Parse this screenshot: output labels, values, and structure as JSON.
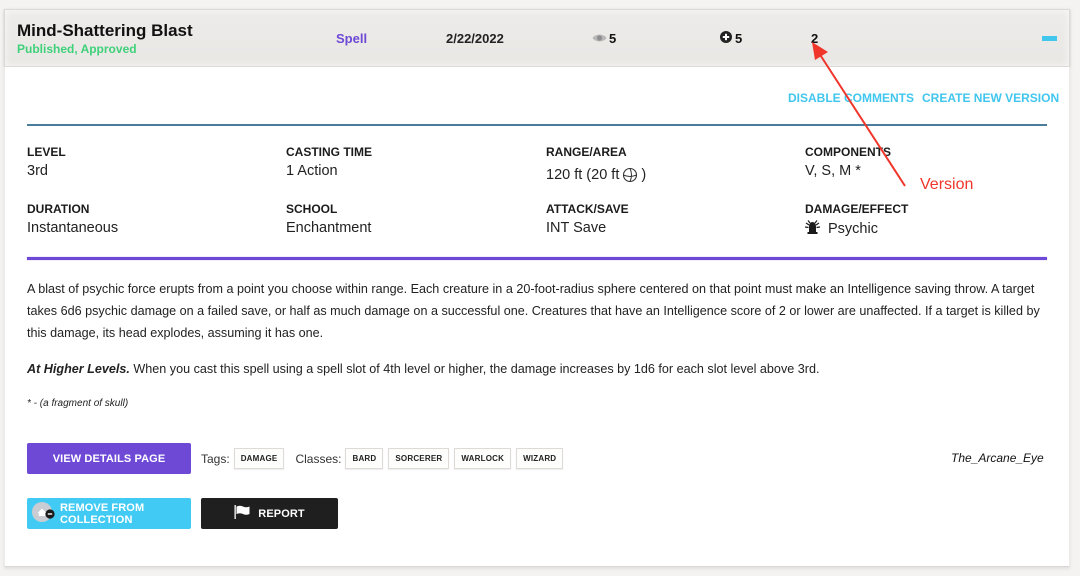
{
  "header": {
    "spell_name": "Mind-Shattering Blast",
    "status": "Published, Approved",
    "type": "Spell",
    "date": "2/22/2022",
    "views": "5",
    "adds": "5",
    "version": "2",
    "collapse_icon": "minus-icon"
  },
  "actions": {
    "disable_comments": "DISABLE COMMENTS",
    "create_new_version": "CREATE NEW VERSION"
  },
  "stats": {
    "level": {
      "label": "LEVEL",
      "value": "3rd"
    },
    "casting_time": {
      "label": "CASTING TIME",
      "value": "1 Action"
    },
    "range_area": {
      "label": "RANGE/AREA",
      "value": "120 ft (20 ft",
      "suffix": ")",
      "icon": "sphere-icon"
    },
    "components": {
      "label": "COMPONENTS",
      "value": "V, S, M *"
    },
    "duration": {
      "label": "DURATION",
      "value": "Instantaneous"
    },
    "school": {
      "label": "SCHOOL",
      "value": "Enchantment"
    },
    "attack_save": {
      "label": "ATTACK/SAVE",
      "value": "INT Save"
    },
    "damage_effect": {
      "label": "DAMAGE/EFFECT",
      "value": "Psychic",
      "icon": "psychic-icon"
    }
  },
  "description": {
    "paragraph1": "A blast of psychic force erupts from a point you choose within range. Each creature in a 20-foot-radius sphere centered on that point must make an Intelligence saving throw. A target takes 6d6 psychic damage on a failed save, or half as much damage on a successful one. Creatures that have an Intelligence score of 2 or lower are unaffected. If a target is killed by this damage, its head explodes, assuming it has one.",
    "higher_levels_label": "At Higher Levels.",
    "higher_levels_text": " When you cast this spell using a spell slot of 4th level or higher, the damage increases by 1d6 for each slot level above 3rd.",
    "footnote": "* - (a fragment of skull)"
  },
  "buttons": {
    "view_details": "VIEW DETAILS PAGE",
    "remove_from_collection": "REMOVE FROM COLLECTION",
    "report": "REPORT"
  },
  "tags": {
    "label": "Tags:",
    "items": [
      "DAMAGE"
    ]
  },
  "classes": {
    "label": "Classes:",
    "items": [
      "BARD",
      "SORCERER",
      "WARLOCK",
      "WIZARD"
    ]
  },
  "author": "The_Arcane_Eye",
  "annotation": {
    "label": "Version",
    "color": "#f0352b"
  },
  "colors": {
    "accent_purple": "#6e49d6",
    "accent_cyan": "#41c6ee",
    "status_green": "#3fd17a",
    "dark_button": "#1f1f20"
  }
}
